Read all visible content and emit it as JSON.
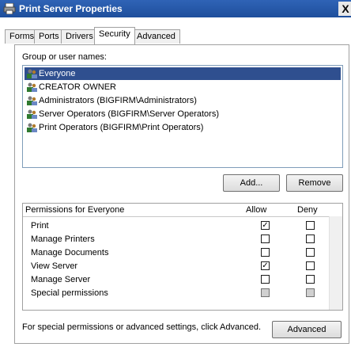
{
  "window": {
    "title": "Print Server Properties",
    "close_glyph": "X"
  },
  "tabs": [
    {
      "label": "Forms"
    },
    {
      "label": "Ports"
    },
    {
      "label": "Drivers"
    },
    {
      "label": "Security",
      "active": true
    },
    {
      "label": "Advanced"
    }
  ],
  "group_label": "Group or user names:",
  "users": [
    {
      "name": "Everyone",
      "selected": true,
      "icon": "group-icon"
    },
    {
      "name": "CREATOR OWNER",
      "icon": "group-icon"
    },
    {
      "name": "Administrators (BIGFIRM\\Administrators)",
      "icon": "group-icon"
    },
    {
      "name": "Server Operators (BIGFIRM\\Server Operators)",
      "icon": "group-icon"
    },
    {
      "name": "Print Operators (BIGFIRM\\Print Operators)",
      "icon": "group-icon"
    }
  ],
  "buttons": {
    "add": "Add...",
    "remove": "Remove",
    "advanced": "Advanced"
  },
  "permissions": {
    "header": "Permissions for Everyone",
    "allow_label": "Allow",
    "deny_label": "Deny",
    "rows": [
      {
        "name": "Print",
        "allow": true,
        "deny": false
      },
      {
        "name": "Manage Printers",
        "allow": false,
        "deny": false
      },
      {
        "name": "Manage Documents",
        "allow": false,
        "deny": false
      },
      {
        "name": "View Server",
        "allow": true,
        "deny": false
      },
      {
        "name": "Manage Server",
        "allow": false,
        "deny": false
      },
      {
        "name": "Special permissions",
        "allow": false,
        "deny": false,
        "disabled": true
      }
    ]
  },
  "footer_text": "For special permissions or advanced settings, click Advanced."
}
